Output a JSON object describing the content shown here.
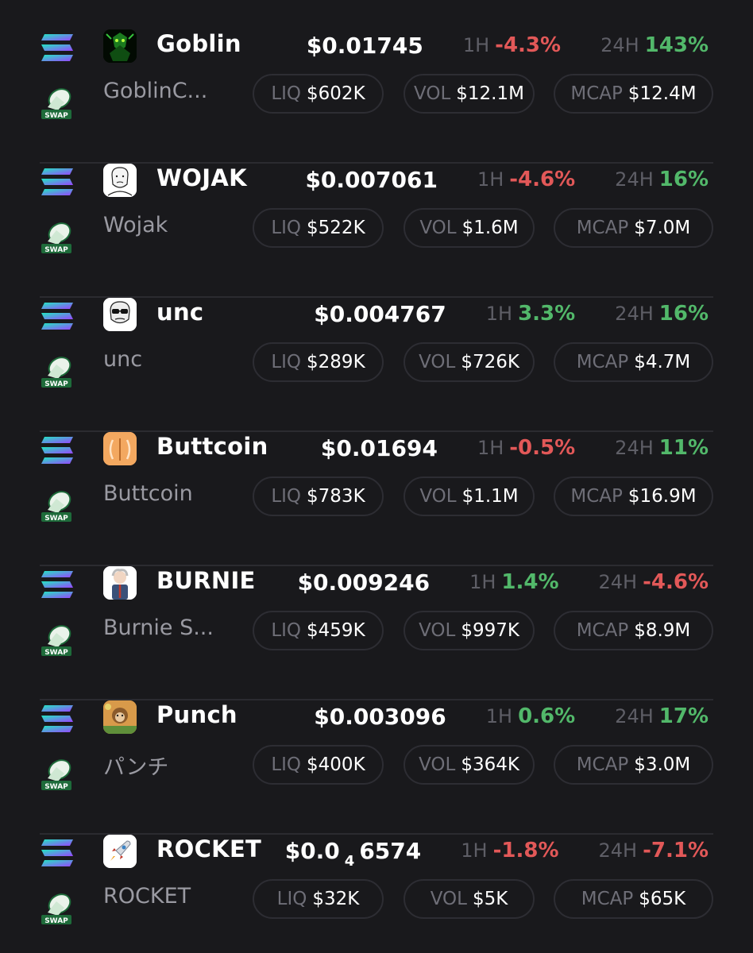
{
  "labels": {
    "h1": "1H",
    "h24": "24H",
    "liq": "LIQ",
    "vol": "VOL",
    "mcap": "MCAP",
    "swap": "SWAP"
  },
  "colors": {
    "negative": "#e25858",
    "positive": "#52b86a",
    "background": "#19191c"
  },
  "tokens": [
    {
      "symbol": "Goblin",
      "name": "GoblinC...",
      "icon": "goblin-avatar-icon",
      "price": "$0.01745",
      "change_1h": "-4.3%",
      "change_24h": "143%",
      "liq": "$602K",
      "vol": "$12.1M",
      "mcap": "$12.4M"
    },
    {
      "symbol": "WOJAK",
      "name": "Wojak",
      "icon": "wojak-avatar-icon",
      "price": "$0.007061",
      "change_1h": "-4.6%",
      "change_24h": "16%",
      "liq": "$522K",
      "vol": "$1.6M",
      "mcap": "$7.0M"
    },
    {
      "symbol": "unc",
      "name": "unc",
      "icon": "unc-avatar-icon",
      "price": "$0.004767",
      "change_1h": "3.3%",
      "change_24h": "16%",
      "liq": "$289K",
      "vol": "$726K",
      "mcap": "$4.7M"
    },
    {
      "symbol": "Buttcoin",
      "name": "Buttcoin",
      "icon": "buttcoin-avatar-icon",
      "price": "$0.01694",
      "change_1h": "-0.5%",
      "change_24h": "11%",
      "liq": "$783K",
      "vol": "$1.1M",
      "mcap": "$16.9M"
    },
    {
      "symbol": "BURNIE",
      "name": "Burnie S...",
      "icon": "burnie-avatar-icon",
      "price": "$0.009246",
      "change_1h": "1.4%",
      "change_24h": "-4.6%",
      "liq": "$459K",
      "vol": "$997K",
      "mcap": "$8.9M"
    },
    {
      "symbol": "Punch",
      "name": "パンチ",
      "icon": "punch-avatar-icon",
      "price": "$0.003096",
      "change_1h": "0.6%",
      "change_24h": "17%",
      "liq": "$400K",
      "vol": "$364K",
      "mcap": "$3.0M"
    },
    {
      "symbol": "ROCKET",
      "name": "ROCKET",
      "icon": "rocket-icon",
      "price": "$0.0",
      "price_sub": "4",
      "price_tail": "6574",
      "change_1h": "-1.8%",
      "change_24h": "-7.1%",
      "liq": "$32K",
      "vol": "$5K",
      "mcap": "$65K"
    }
  ]
}
